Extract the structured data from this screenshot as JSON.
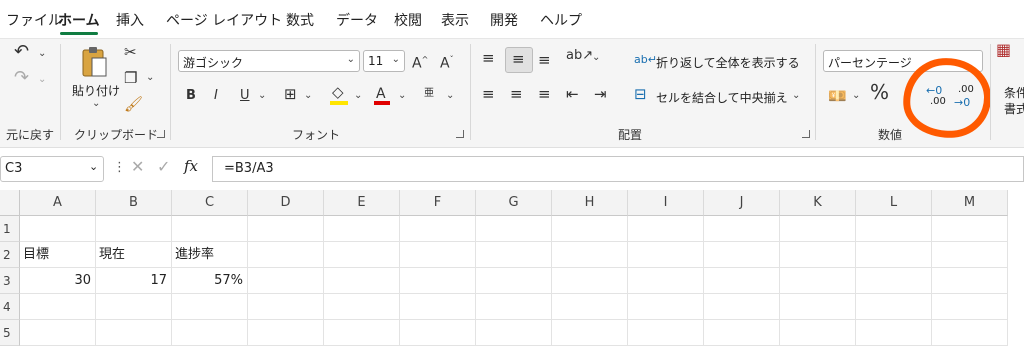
{
  "menu": {
    "tabs": [
      {
        "label": "ファイル"
      },
      {
        "label": "ホーム"
      },
      {
        "label": "挿入"
      },
      {
        "label": "ページ レイアウト"
      },
      {
        "label": "数式"
      },
      {
        "label": "データ"
      },
      {
        "label": "校閲"
      },
      {
        "label": "表示"
      },
      {
        "label": "開発"
      },
      {
        "label": "ヘルプ"
      }
    ],
    "active": "ホーム"
  },
  "ribbon": {
    "groups": {
      "undo": "元に戻す",
      "clipboard": "クリップボード",
      "font": "フォント",
      "alignment": "配置",
      "number": "数値"
    },
    "clipboard": {
      "paste_label": "貼り付け"
    },
    "font": {
      "name": "游ゴシック",
      "size": "11"
    },
    "alignment": {
      "wrap_text": "折り返して全体を表示する",
      "merge_center": "セルを結合して中央揃え"
    },
    "number": {
      "format": "パーセンテージ",
      "percent": "%",
      "decrease_decimal": ".00",
      "increase_decimal": ".00"
    },
    "styles_partial": [
      "条件",
      "書式"
    ]
  },
  "formula_bar": {
    "name_box": "C3",
    "fx": "fx",
    "formula": "=B3/A3"
  },
  "grid": {
    "columns": [
      "A",
      "B",
      "C",
      "D",
      "E",
      "F",
      "G",
      "H",
      "I",
      "J",
      "K",
      "L",
      "M"
    ],
    "rows": [
      "1",
      "2",
      "3",
      "4",
      "5"
    ],
    "cells": {
      "A2": "目標",
      "B2": "現在",
      "C2": "進捗率",
      "A3": "30",
      "B3": "17",
      "C3": "57%"
    }
  },
  "colors": {
    "accent": "#107c41",
    "annotation": "#ff5a00"
  }
}
